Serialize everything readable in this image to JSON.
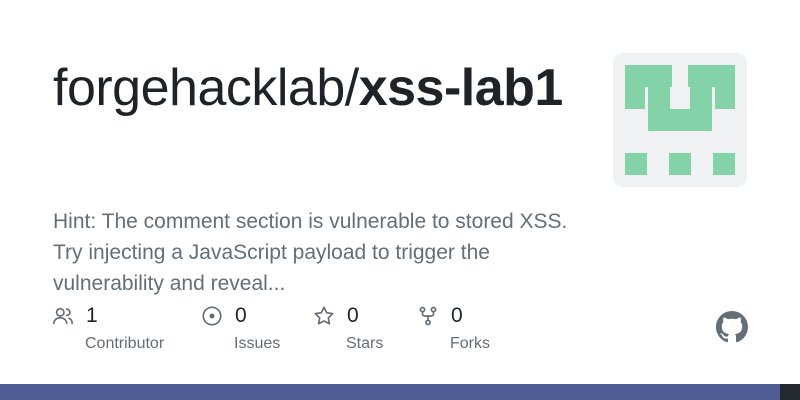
{
  "repo": {
    "owner": "forgehacklab/",
    "name": "xss-lab1",
    "description": "Hint: The comment section is vulnerable to stored XSS. Try injecting a JavaScript payload to trigger the vulnerability and reveal..."
  },
  "stats": [
    {
      "icon": "people-icon",
      "count": "1",
      "label": "Contributor"
    },
    {
      "icon": "issue-icon",
      "count": "0",
      "label": "Issues"
    },
    {
      "icon": "star-icon",
      "count": "0",
      "label": "Stars"
    },
    {
      "icon": "fork-icon",
      "count": "0",
      "label": "Forks"
    }
  ],
  "colors": {
    "identicon": "#84d2a8",
    "identicon_bg": "#f0f1f2",
    "bar_main": "#4f5b93",
    "bar_end": "#24292f",
    "text_primary": "#1f2328",
    "text_secondary": "#656d76"
  },
  "language_bar": [
    {
      "color": "#4f5b93",
      "fraction": 0.975
    },
    {
      "color": "#24292f",
      "fraction": 0.025
    }
  ]
}
